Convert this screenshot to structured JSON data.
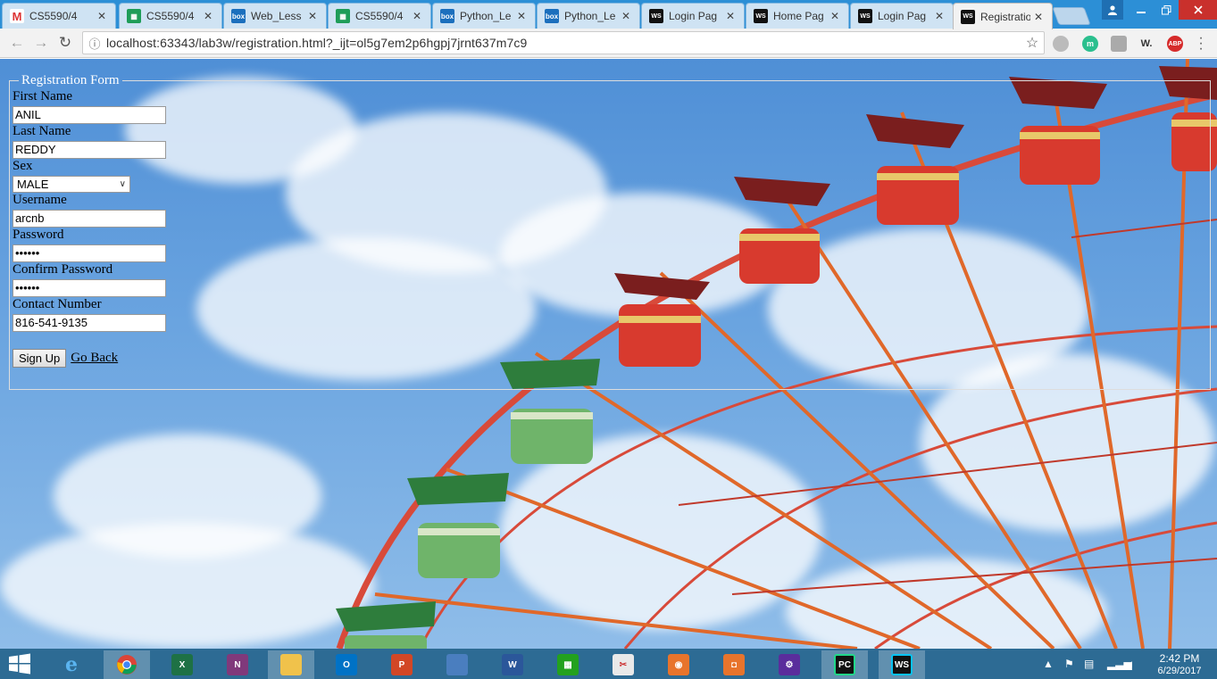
{
  "browser": {
    "tabs": [
      {
        "title": "CS5590/4",
        "icon": "gmail-icon"
      },
      {
        "title": "CS5590/4",
        "icon": "sheets-icon"
      },
      {
        "title": "Web_Less",
        "icon": "box-icon"
      },
      {
        "title": "CS5590/4",
        "icon": "sheets-icon"
      },
      {
        "title": "Python_Le",
        "icon": "box-icon"
      },
      {
        "title": "Python_Le",
        "icon": "box-icon"
      },
      {
        "title": "Login Pag",
        "icon": "webstorm-icon"
      },
      {
        "title": "Home Pag",
        "icon": "webstorm-icon"
      },
      {
        "title": "Login Pag",
        "icon": "webstorm-icon"
      },
      {
        "title": "Registratio",
        "icon": "webstorm-icon"
      }
    ],
    "active_tab": 9,
    "url": "localhost:63343/lab3w/registration.html?_ijt=ol5g7em2p6hgpj7jrnt637m7c9",
    "extensions": [
      {
        "name": "profile-ext-icon",
        "label": ""
      },
      {
        "name": "m-ext-icon",
        "label": "m"
      },
      {
        "name": "puzzle-ext-icon",
        "label": ""
      },
      {
        "name": "w-ext-icon",
        "label": "W."
      },
      {
        "name": "abp-ext-icon",
        "label": "ABP"
      }
    ]
  },
  "form": {
    "legend": "Registration Form",
    "first_name_label": "First Name",
    "first_name_value": "ANIL",
    "last_name_label": "Last Name",
    "last_name_value": "REDDY",
    "sex_label": "Sex",
    "sex_value": "MALE",
    "username_label": "Username",
    "username_value": "arcnb",
    "password_label": "Password",
    "password_value": "••••••",
    "confirm_label": "Confirm Password",
    "confirm_value": "••••••",
    "contact_label": "Contact Number",
    "contact_value": "816-541-9135",
    "signup_label": "Sign Up",
    "goback_label": "Go Back"
  },
  "taskbar": {
    "apps": [
      "internet-explorer",
      "chrome",
      "excel",
      "onenote",
      "file-explorer",
      "outlook",
      "powerpoint",
      "remote-desktop",
      "word",
      "project",
      "snipping",
      "screen-recorder",
      "camera",
      "settings",
      "pycharm",
      "webstorm"
    ],
    "active_app": "chrome",
    "time": "2:42 PM",
    "date": "6/29/2017"
  },
  "colors": {
    "sky": "#5d99dc",
    "wheel_red": "#d84a3a",
    "tabstrip": "#2c8fd6",
    "taskbar": "#2d6b94"
  }
}
